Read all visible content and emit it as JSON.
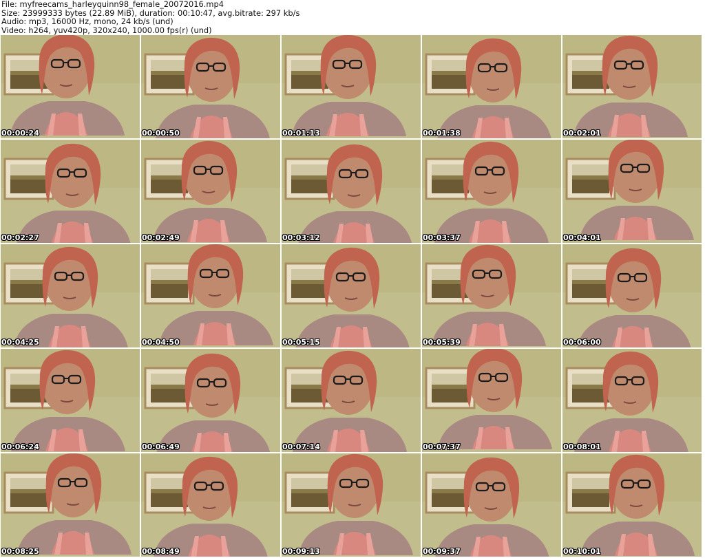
{
  "file_info": {
    "file": "File: myfreecams_harleyquinn98_female_20072016.mp4",
    "size": "Size: 23999333 bytes (22.89 MiB), duration: 00:10:47, avg.bitrate: 297 kb/s",
    "audio": "Audio: mp3, 16000 Hz, mono, 24 kb/s (und)",
    "video": "Video: h264, yuv420p, 320x240, 1000.00 fps(r) (und)"
  },
  "thumbnails": [
    {
      "timestamp": "00:00:24"
    },
    {
      "timestamp": "00:00:50"
    },
    {
      "timestamp": "00:01:13"
    },
    {
      "timestamp": "00:01:38"
    },
    {
      "timestamp": "00:02:01"
    },
    {
      "timestamp": "00:02:27"
    },
    {
      "timestamp": "00:02:49"
    },
    {
      "timestamp": "00:03:12"
    },
    {
      "timestamp": "00:03:37"
    },
    {
      "timestamp": "00:04:01"
    },
    {
      "timestamp": "00:04:25"
    },
    {
      "timestamp": "00:04:50"
    },
    {
      "timestamp": "00:05:15"
    },
    {
      "timestamp": "00:05:39"
    },
    {
      "timestamp": "00:06:00"
    },
    {
      "timestamp": "00:06:24"
    },
    {
      "timestamp": "00:06:49"
    },
    {
      "timestamp": "00:07:14"
    },
    {
      "timestamp": "00:07:37"
    },
    {
      "timestamp": "00:08:01"
    },
    {
      "timestamp": "00:08:25"
    },
    {
      "timestamp": "00:08:49"
    },
    {
      "timestamp": "00:09:13"
    },
    {
      "timestamp": "00:09:37"
    },
    {
      "timestamp": "00:10:01"
    }
  ]
}
